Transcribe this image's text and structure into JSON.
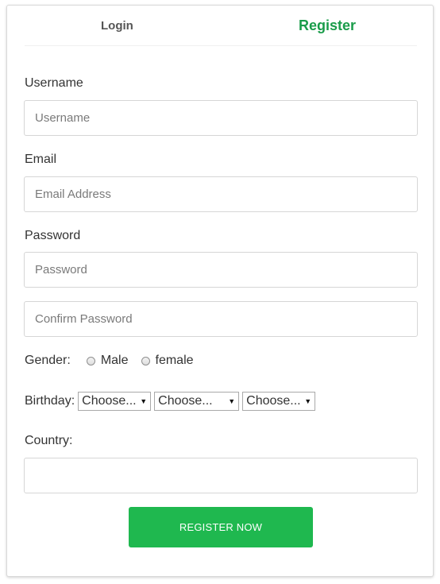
{
  "tabs": {
    "login": "Login",
    "register": "Register"
  },
  "form": {
    "username": {
      "label": "Username",
      "placeholder": "Username",
      "value": ""
    },
    "email": {
      "label": "Email",
      "placeholder": "Email Address",
      "value": ""
    },
    "password": {
      "label": "Password",
      "placeholder": "Password",
      "value": ""
    },
    "confirm_password": {
      "placeholder": "Confirm Password",
      "value": ""
    },
    "gender": {
      "label": "Gender:",
      "options": [
        "Male",
        "female"
      ]
    },
    "birthday": {
      "label": "Birthday:",
      "day": "Choose...",
      "month": "Choose...",
      "year": "Choose..."
    },
    "country": {
      "label": "Country:",
      "value": ""
    },
    "submit_label": "REGISTER NOW"
  },
  "colors": {
    "accent": "#1a9c4a",
    "button": "#1fb84f"
  }
}
